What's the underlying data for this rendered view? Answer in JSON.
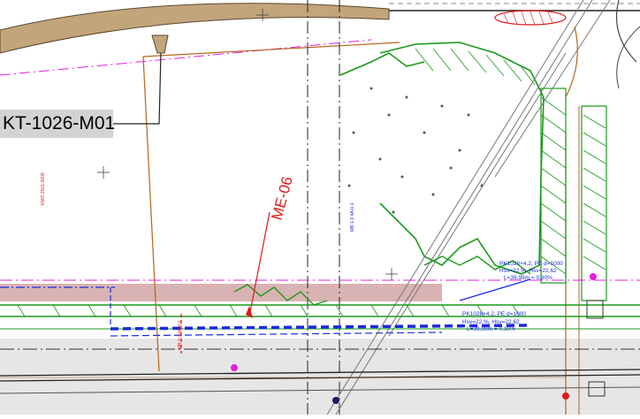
{
  "drawing": {
    "callout_label": "KT-1026-M01",
    "view_label": "ME-06",
    "profile_upper": {
      "l1": "PK1026+4,2, PE d=1000",
      "l2": "Hsv=22,%, Hsv=22,62",
      "l3": "L=39,99m = 0,30%"
    },
    "profile_lower": {
      "l1": "PK1026+4,2, PE d=1000",
      "l2": "Hsv=22,%, Hsv=22,62",
      "l3": "L=39,99m = 0,30%"
    },
    "small_labels": {
      "vertical_left": "KMO 2501-0009",
      "vertical_mid": "MB 1-3 4A-0-1",
      "vertical_red": "MB 1-3 4A-0-1"
    }
  },
  "colors": {
    "green": "#1a9a1a",
    "brown": "#b5651d",
    "magenta": "#e020e0",
    "blue": "#1a2be0",
    "red": "#e01818",
    "pink_band": "#d9b3b3",
    "road": "#c2a57a",
    "gray_band": "#e6e6e6"
  }
}
